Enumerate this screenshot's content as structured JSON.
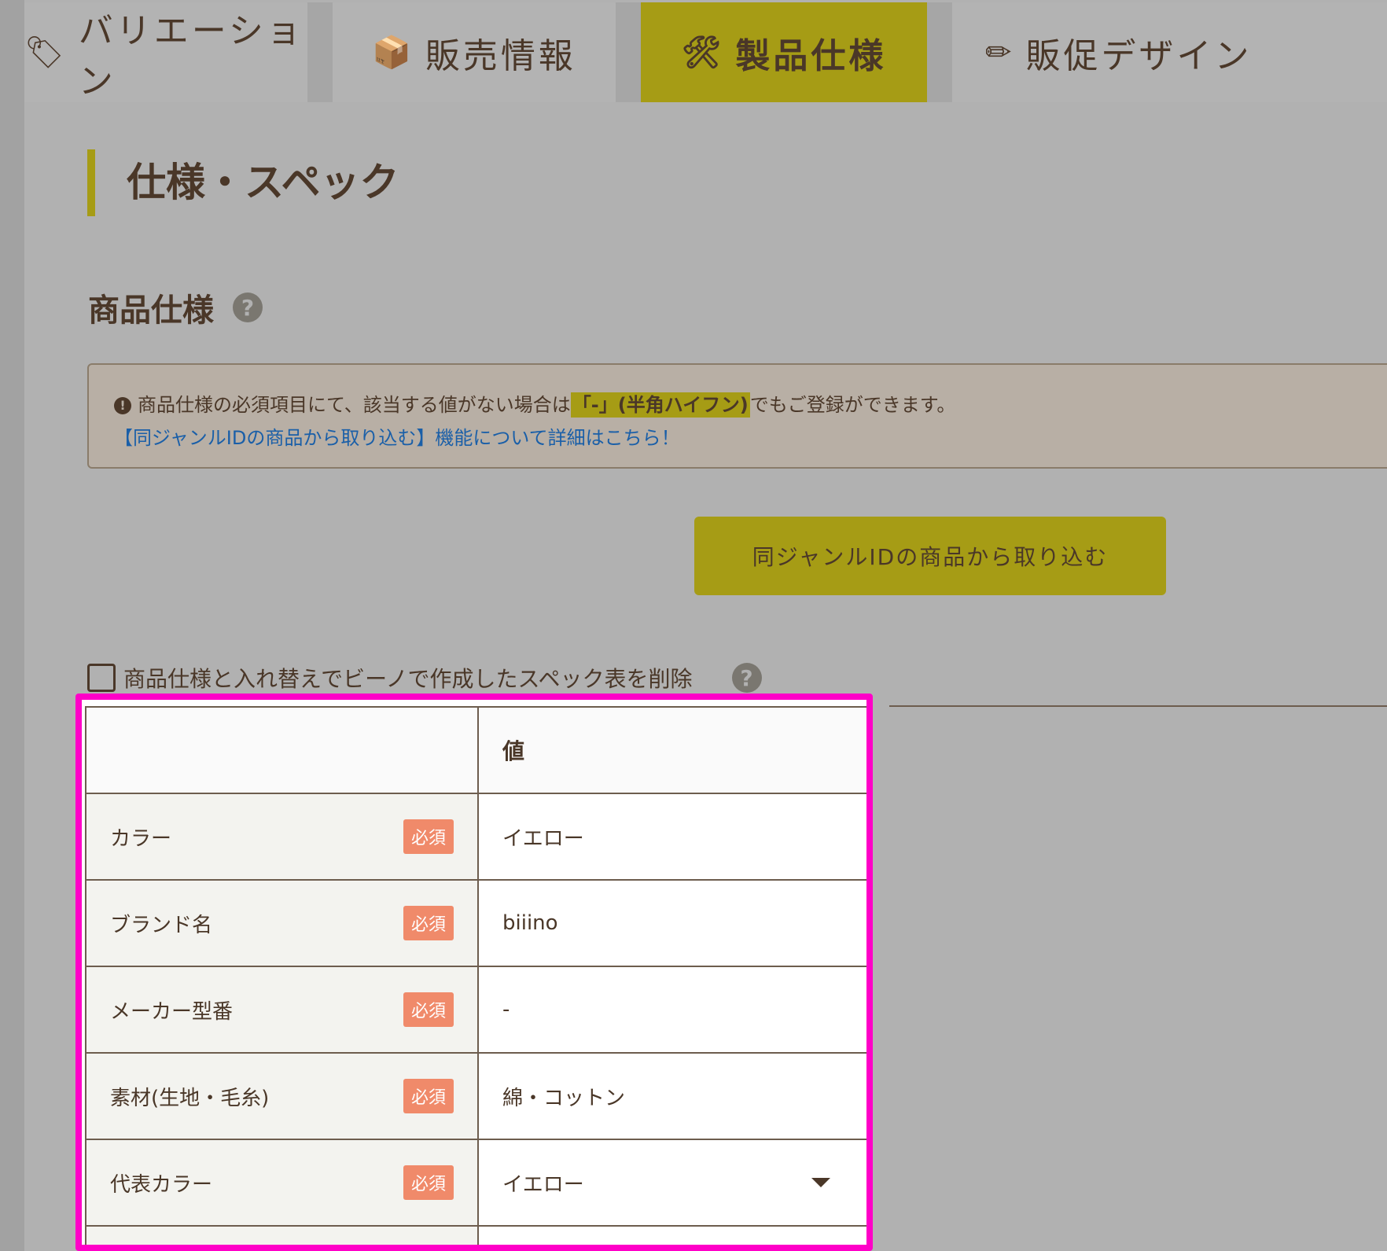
{
  "tabs": [
    {
      "icon": "🏷",
      "label": "バリエーション",
      "active": false
    },
    {
      "icon": "📦",
      "label": "販売情報",
      "active": false
    },
    {
      "icon": "🛠",
      "label": "製品仕様",
      "active": true
    },
    {
      "icon": "✏",
      "label": "販促デザイン",
      "active": false
    }
  ],
  "section_title": "仕様・スペック",
  "subsection_title": "商品仕様",
  "help_glyph": "?",
  "notice": {
    "excl": "!",
    "text_before": "商品仕様の必須項目にて、該当する値がない場合は",
    "highlight": "「-」(半角ハイフン)",
    "text_after": "でもご登録ができます。",
    "link": "【同ジャンルIDの商品から取り込む】機能について詳細はこちら！"
  },
  "import_button_label": "同ジャンルIDの商品から取り込む",
  "checkbox_label": "商品仕様と入れ替えでビーノで作成したスペック表を削除",
  "table": {
    "header_label": "",
    "header_value": "値",
    "rows": [
      {
        "label": "カラー",
        "badge": "必須",
        "value": "イエロー",
        "select": false
      },
      {
        "label": "ブランド名",
        "badge": "必須",
        "value": "biiino",
        "select": false
      },
      {
        "label": "メーカー型番",
        "badge": "必須",
        "value": "-",
        "select": false
      },
      {
        "label": "素材(生地・毛糸)",
        "badge": "必須",
        "value": "綿・コットン",
        "select": false
      },
      {
        "label": "代表カラー",
        "badge": "必須",
        "value": "イエロー",
        "select": true
      }
    ]
  }
}
